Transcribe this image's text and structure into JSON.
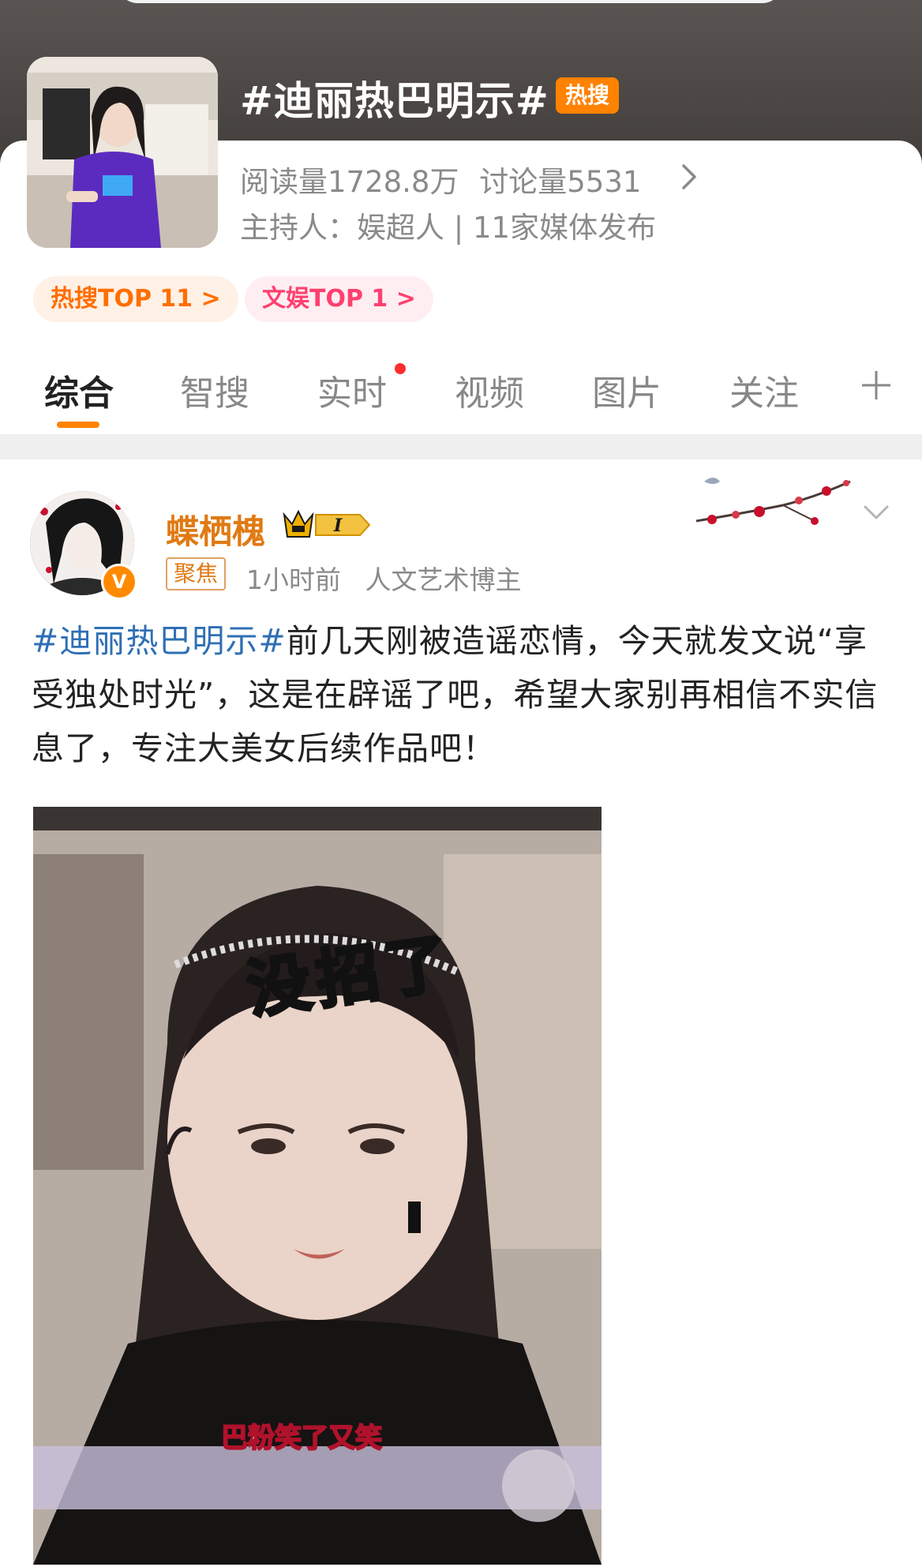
{
  "topic": {
    "title": "#迪丽热巴明示#",
    "hot_badge": "热搜",
    "reads_label": "阅读量1728.8万",
    "discussions_label": "讨论量5531",
    "host_line": "主持人：娱超人 | 11家媒体发布",
    "ranks": [
      {
        "label": "热搜TOP 11 >"
      },
      {
        "label": "文娱TOP 1 >"
      }
    ]
  },
  "tabs": [
    {
      "label": "综合",
      "active": true
    },
    {
      "label": "智搜",
      "active": false
    },
    {
      "label": "实时",
      "active": false
    },
    {
      "label": "视频",
      "active": false
    },
    {
      "label": "图片",
      "active": false
    },
    {
      "label": "关注",
      "active": false
    }
  ],
  "post": {
    "username": "蝶栖槐",
    "badge_level": "I",
    "verify_mark": "V",
    "focus_tag": "聚焦",
    "time": "1小时前",
    "identity": "人文艺术博主",
    "hashtag": "#迪丽热巴明示#",
    "text": "前几天刚被造谣恋情，今天就发文说“享受独处时光”，这是在辟谣了吧，希望大家别再相信不实信息了，专注大美女后续作品吧！",
    "image": {
      "caption_big": "没招了",
      "caption_sub": "巴粉笑了又笑"
    }
  },
  "colors": {
    "accent": "#ff8200",
    "hashtag": "#2f6fb5",
    "username": "#e07a14"
  }
}
